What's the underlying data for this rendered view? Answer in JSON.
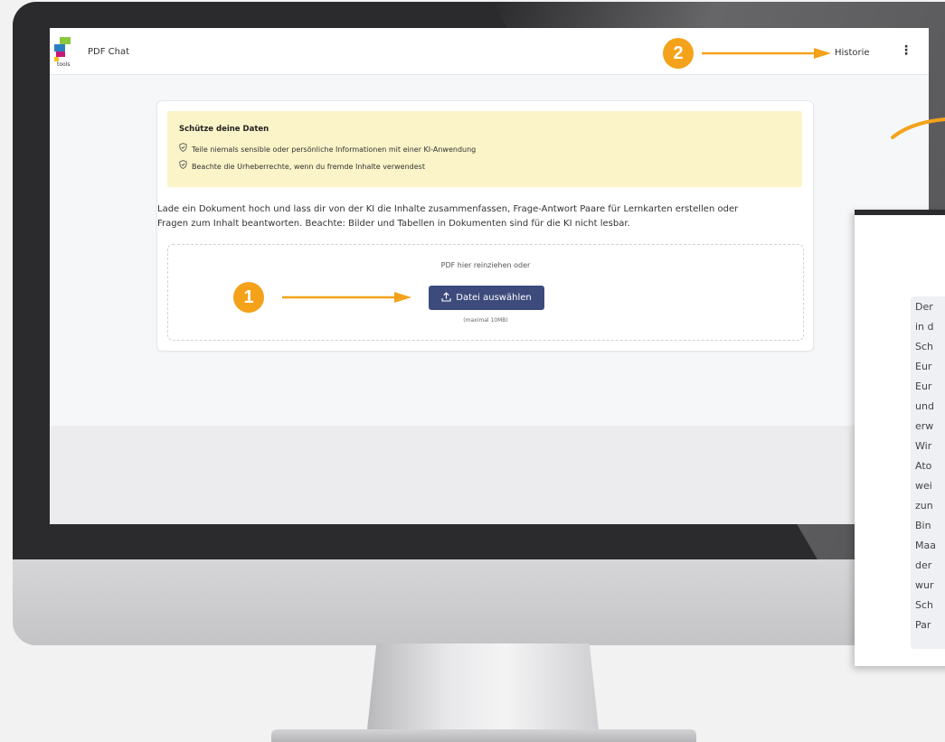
{
  "app": {
    "title": "PDF Chat",
    "logo_text": "tools",
    "history_label": "Historie",
    "more_label": "⋮"
  },
  "notice": {
    "title": "Schütze deine Daten",
    "lines": [
      "Teile niemals sensible oder persönliche Informationen mit einer KI-Anwendung",
      "Beachte die Urheberrechte, wenn du fremde Inhalte verwendest"
    ]
  },
  "description": {
    "line1": "Lade ein Dokument hoch und lass dir von der KI die Inhalte zusammenfassen, Frage-Antwort Paare für Lernkarten erstellen oder",
    "line2": "Fragen zum Inhalt beantworten. Beachte: Bilder und Tabellen in Dokumenten sind für die KI nicht lesbar."
  },
  "upload": {
    "hint": "PDF hier reinziehen oder",
    "button_label": "Datei auswählen",
    "limit": "(maximal 10MB)"
  },
  "annotations": {
    "step1": "1",
    "step2": "2"
  },
  "overlay_text": [
    "Der",
    "in d",
    "Sch",
    "Eur",
    "Eur",
    "und",
    "erw",
    "Wir",
    "Ato",
    "wei",
    "zun",
    "Bin",
    "Maa",
    "der",
    "wur",
    "Sch",
    "Par"
  ],
  "colors": {
    "accent": "#f4a21a",
    "button": "#3d4b7c",
    "notice_bg": "#faf4c8"
  }
}
